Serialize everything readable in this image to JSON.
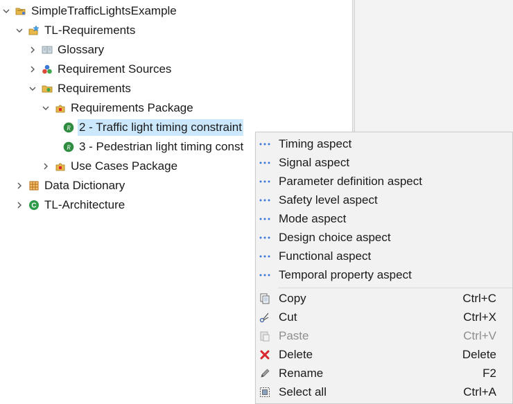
{
  "tree": {
    "root": {
      "label": "SimpleTrafficLightsExample",
      "icon": "project-folder-icon"
    },
    "tl_requirements": {
      "label": "TL-Requirements",
      "icon": "star-folder-icon"
    },
    "glossary": {
      "label": "Glossary",
      "icon": "book-icon"
    },
    "requirement_sources": {
      "label": "Requirement Sources",
      "icon": "sources-icon"
    },
    "requirements": {
      "label": "Requirements",
      "icon": "requirements-folder-icon"
    },
    "requirements_package": {
      "label": "Requirements Package",
      "icon": "package-icon"
    },
    "req2": {
      "label": "2 - Traffic light timing constraint",
      "icon": "requirement-r-icon"
    },
    "req3": {
      "label": "3 - Pedestrian light timing const",
      "icon": "requirement-r-icon"
    },
    "use_cases_package": {
      "label": "Use Cases Package",
      "icon": "package-icon"
    },
    "data_dictionary": {
      "label": "Data Dictionary",
      "icon": "grid-icon"
    },
    "tl_architecture": {
      "label": "TL-Architecture",
      "icon": "architecture-c-icon"
    }
  },
  "context_menu": {
    "aspects": [
      {
        "label": "Timing aspect",
        "icon": "aspect-dots-icon"
      },
      {
        "label": "Signal aspect",
        "icon": "aspect-dots-icon"
      },
      {
        "label": "Parameter definition aspect",
        "icon": "aspect-dots-icon"
      },
      {
        "label": "Safety level aspect",
        "icon": "aspect-dots-icon"
      },
      {
        "label": "Mode aspect",
        "icon": "aspect-dots-icon"
      },
      {
        "label": "Design choice aspect",
        "icon": "aspect-dots-icon"
      },
      {
        "label": "Functional aspect",
        "icon": "aspect-dots-icon"
      },
      {
        "label": "Temporal property aspect",
        "icon": "aspect-dots-icon"
      }
    ],
    "actions": [
      {
        "label": "Copy",
        "shortcut": "Ctrl+C",
        "icon": "copy-icon",
        "enabled": true
      },
      {
        "label": "Cut",
        "shortcut": "Ctrl+X",
        "icon": "scissors-icon",
        "enabled": true
      },
      {
        "label": "Paste",
        "shortcut": "Ctrl+V",
        "icon": "paste-icon",
        "enabled": false
      },
      {
        "label": "Delete",
        "shortcut": "Delete",
        "icon": "delete-x-icon",
        "enabled": true
      },
      {
        "label": "Rename",
        "shortcut": "F2",
        "icon": "pencil-icon",
        "enabled": true
      },
      {
        "label": "Select all",
        "shortcut": "Ctrl+A",
        "icon": "select-all-icon",
        "enabled": true
      }
    ]
  },
  "colors": {
    "selection": "#cce8ff",
    "menu_bg": "#f2f2f2",
    "delete_red": "#d9262c",
    "requirement_green": "#2e8b3f",
    "aspect_blue": "#3c78d8"
  }
}
